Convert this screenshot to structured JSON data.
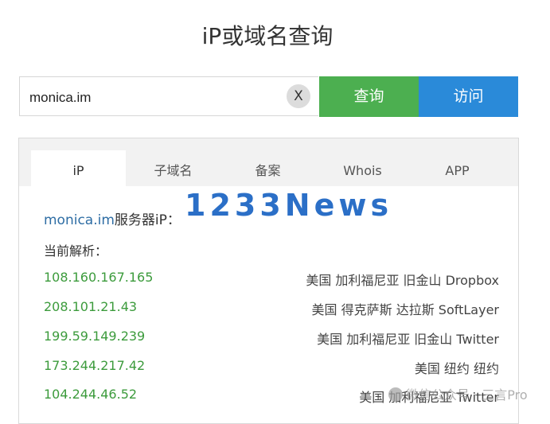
{
  "page": {
    "title": "iP或域名查询"
  },
  "search": {
    "value": "monica.im",
    "clear_label": "X",
    "query_label": "查询",
    "visit_label": "访问"
  },
  "tabs": [
    {
      "label": "iP",
      "active": true
    },
    {
      "label": "子域名",
      "active": false
    },
    {
      "label": "备案",
      "active": false
    },
    {
      "label": "Whois",
      "active": false
    },
    {
      "label": "APP",
      "active": false
    }
  ],
  "result": {
    "domain": "monica.im",
    "server_ip_label": "服务器iP：",
    "current_label": "当前解析：",
    "rows": [
      {
        "ip": "108.160.167.165",
        "location": "美国 加利福尼亚 旧金山 Dropbox"
      },
      {
        "ip": "208.101.21.43",
        "location": "美国 得克萨斯 达拉斯 SoftLayer"
      },
      {
        "ip": "199.59.149.239",
        "location": "美国 加利福尼亚 旧金山 Twitter"
      },
      {
        "ip": "173.244.217.42",
        "location": "美国 纽约 纽约"
      },
      {
        "ip": "104.244.46.52",
        "location": "美国 加利福尼亚 Twitter"
      }
    ]
  },
  "watermarks": {
    "overlay": "1233News",
    "bottom": "微信公众号 · 三言Pro"
  },
  "colors": {
    "query_button": "#4caf50",
    "visit_button": "#2a8ad9",
    "ip_text": "#3c9b3c",
    "domain_link": "#2e6da4"
  }
}
